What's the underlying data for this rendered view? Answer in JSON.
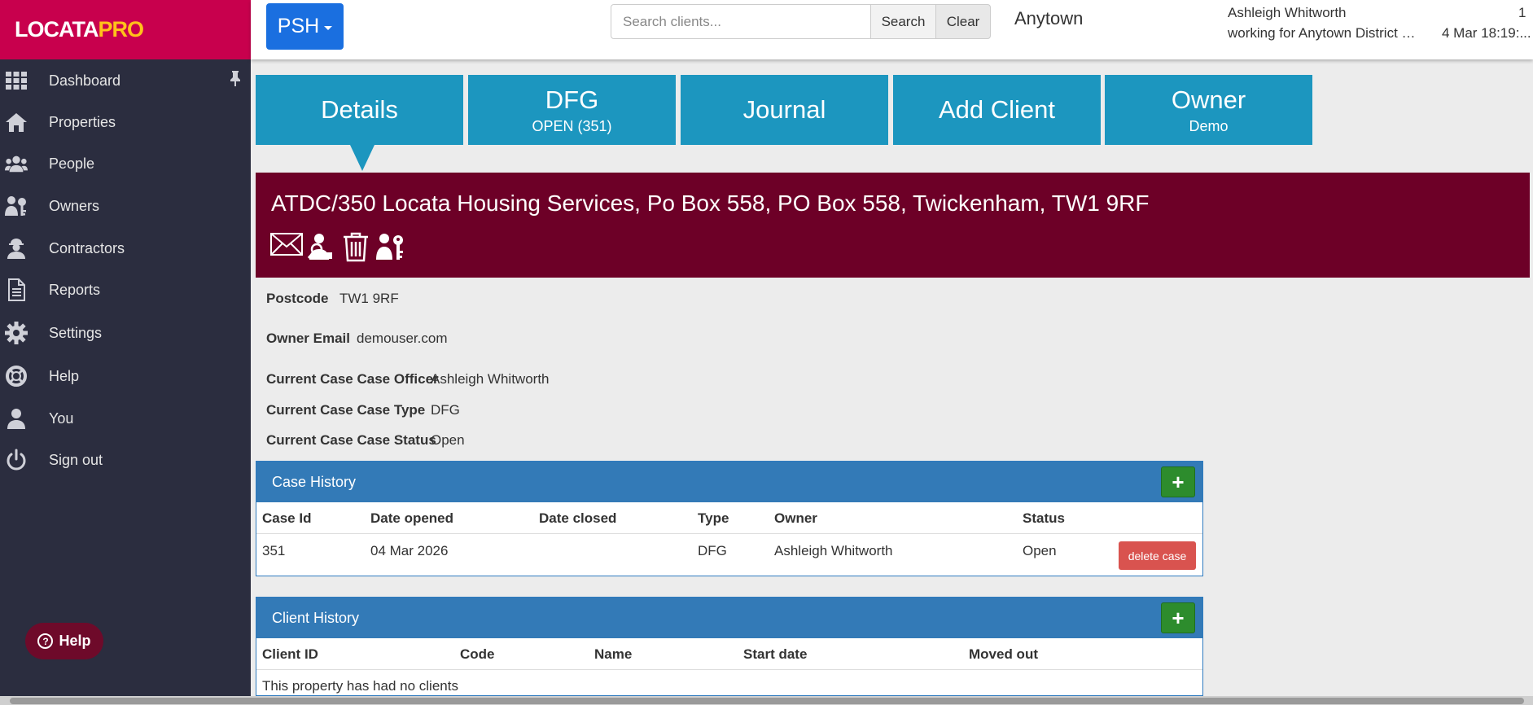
{
  "brand": {
    "logo_main": "LOCATA",
    "logo_accent": "PRO"
  },
  "sidebar": {
    "items": [
      {
        "label": "Dashboard",
        "icon": "grid-icon"
      },
      {
        "label": "Properties",
        "icon": "home-icon"
      },
      {
        "label": "People",
        "icon": "people-icon"
      },
      {
        "label": "Owners",
        "icon": "owner-key-icon"
      },
      {
        "label": "Contractors",
        "icon": "contractor-icon"
      },
      {
        "label": "Reports",
        "icon": "document-icon"
      },
      {
        "label": "Settings",
        "icon": "gear-icon"
      },
      {
        "label": "Help",
        "icon": "lifebuoy-icon"
      },
      {
        "label": "You",
        "icon": "user-icon"
      },
      {
        "label": "Sign out",
        "icon": "power-icon"
      }
    ],
    "help_pill": "Help"
  },
  "header": {
    "workspace_button": "PSH",
    "search_placeholder": "Search clients...",
    "search_label": "Search",
    "clear_label": "Clear",
    "location": "Anytown",
    "user_name": "Ashleigh Whitworth",
    "user_org": "working for Anytown District C...",
    "notification_count": "1",
    "datetime": "4 Mar 18:19:..."
  },
  "tiles": [
    {
      "title": "Details",
      "sub": ""
    },
    {
      "title": "DFG",
      "sub": "OPEN (351)"
    },
    {
      "title": "Journal",
      "sub": ""
    },
    {
      "title": "Add Client",
      "sub": ""
    },
    {
      "title": "Owner",
      "sub": "Demo"
    }
  ],
  "property": {
    "title": "ATDC/350 Locata Housing Services, Po Box 558, PO Box 558, Twickenham, TW1 9RF",
    "actions": [
      "email-icon",
      "inspect-person-icon",
      "trash-icon",
      "owner-key-icon"
    ]
  },
  "details": [
    {
      "label": "Postcode",
      "value": "TW1 9RF"
    },
    {
      "label": "Owner Email",
      "value": "demouser.com"
    },
    {
      "label": "Current Case Case Officer",
      "value": "Ashleigh Whitworth"
    },
    {
      "label": "Current Case Case Type",
      "value": "DFG"
    },
    {
      "label": "Current Case Case Status",
      "value": "Open"
    }
  ],
  "case_history": {
    "title": "Case History",
    "add_label": "+",
    "columns": [
      "Case Id",
      "Date opened",
      "Date closed",
      "Type",
      "Owner",
      "Status"
    ],
    "rows": [
      {
        "case_id": "351",
        "date_opened": "04 Mar 2026",
        "date_closed": "",
        "type": "DFG",
        "owner": "Ashleigh Whitworth",
        "status": "Open"
      }
    ],
    "delete_label": "delete case"
  },
  "client_history": {
    "title": "Client History",
    "add_label": "+",
    "columns": [
      "Client ID",
      "Code",
      "Name",
      "Start date",
      "Moved out"
    ],
    "empty_message": "This property has had no clients"
  },
  "colors": {
    "brand": "#c8004d",
    "brand_accent": "#ffc21a",
    "sidebar": "#2b2d3f",
    "tile": "#1c96bf",
    "banner": "#6d0027",
    "panel_head": "#337ab7",
    "add_button": "#2d8c2d",
    "delete_button": "#d9534f",
    "primary_button": "#1a6fe0"
  }
}
